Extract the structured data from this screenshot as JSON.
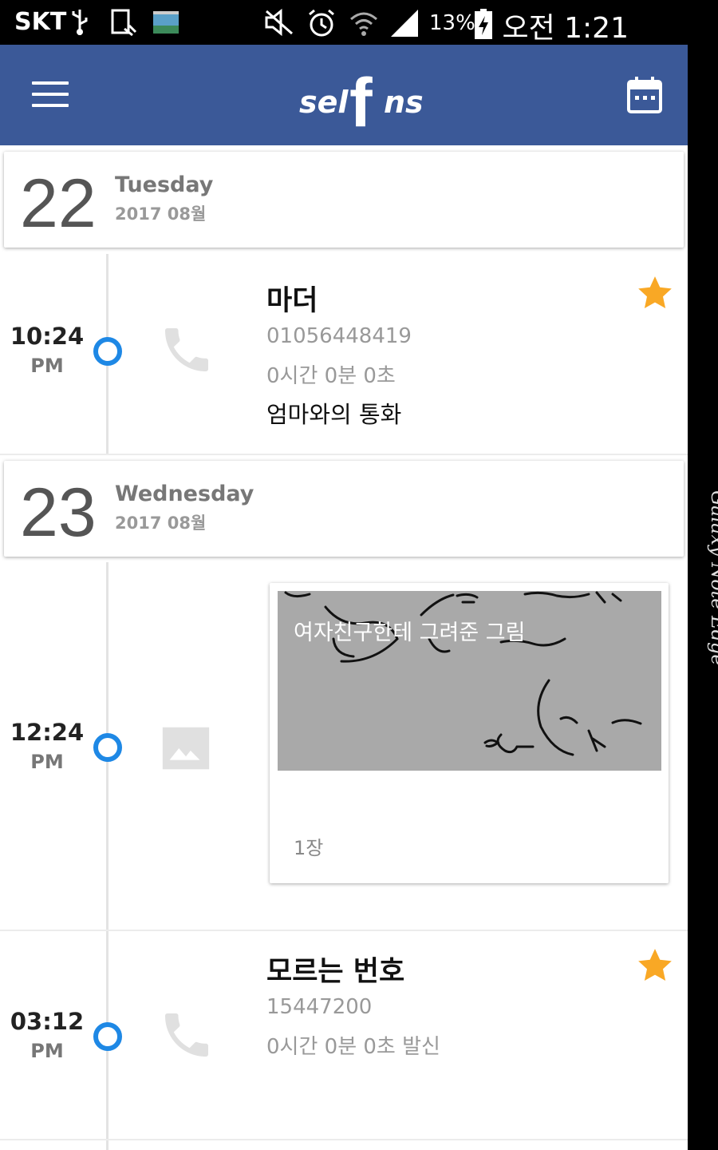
{
  "status_bar": {
    "carrier": "SKT",
    "battery_pct": "13%",
    "clock": "오전 1:21"
  },
  "app_bar": {
    "logo_left": "sel",
    "logo_f": "f",
    "logo_right": "ns"
  },
  "days": [
    {
      "day": "22",
      "weekday": "Tuesday",
      "year_month": "2017 08월"
    },
    {
      "day": "23",
      "weekday": "Wednesday",
      "year_month": "2017 08월"
    }
  ],
  "entries": [
    {
      "type": "call",
      "time": "10:24",
      "ampm": "PM",
      "title": "마더",
      "number": "01056448419",
      "duration": "0시간 0분 0초",
      "memo": "엄마와의 통화",
      "starred": true
    },
    {
      "type": "photo",
      "time": "12:24",
      "ampm": "PM",
      "caption": "여자친구한테 그려준 그림",
      "count": "1장"
    },
    {
      "type": "call",
      "time": "03:12",
      "ampm": "PM",
      "title": "모르는 번호",
      "number": "15447200",
      "duration": "0시간 0분 0초 발신",
      "starred": true
    }
  ],
  "side_edge": {
    "brand": "Galaxy Note Edge"
  },
  "colors": {
    "app_bar": "#3b5998",
    "timeline_dot": "#1e88e5",
    "star": "#f9a825"
  }
}
